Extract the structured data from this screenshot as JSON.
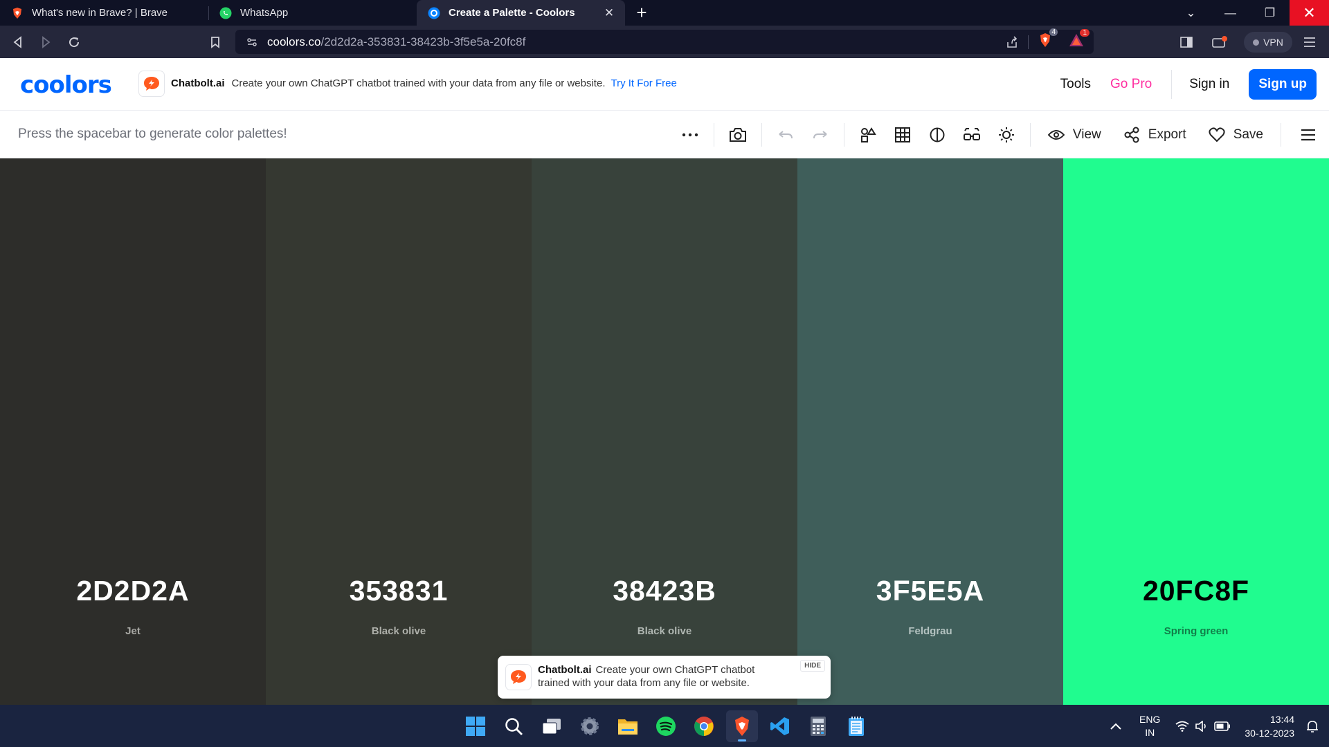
{
  "browser": {
    "tabs": [
      {
        "title": "What's new in Brave? | Brave",
        "icon": "brave-icon",
        "active": false
      },
      {
        "title": "WhatsApp",
        "icon": "whatsapp-icon",
        "active": false
      },
      {
        "title": "Create a Palette - Coolors",
        "icon": "coolors-icon",
        "active": true
      }
    ],
    "url_domain": "coolors.co",
    "url_path": "/2d2d2a-353831-38423b-3f5e5a-20fc8f",
    "shields_count": "4",
    "rewards_count": "1",
    "vpn_label": "VPN"
  },
  "header": {
    "logo": "coolors",
    "ad_brand": "Chatbolt.ai",
    "ad_text": "Create your own ChatGPT chatbot trained with your data from any file or website.",
    "ad_cta": "Try It For Free",
    "tools_label": "Tools",
    "gopro_label": "Go Pro",
    "signin_label": "Sign in",
    "signup_label": "Sign up"
  },
  "toolbar": {
    "hint": "Press the spacebar to generate color palettes!",
    "view_label": "View",
    "export_label": "Export",
    "save_label": "Save"
  },
  "palette": [
    {
      "hex": "2D2D2A",
      "name": "Jet",
      "color": "#2d2d2a",
      "text_color": "#ffffff",
      "name_color": "#a9a9a5"
    },
    {
      "hex": "353831",
      "name": "Black olive",
      "color": "#353831",
      "text_color": "#ffffff",
      "name_color": "#aeb0aa"
    },
    {
      "hex": "38423B",
      "name": "Black olive",
      "color": "#38423b",
      "text_color": "#ffffff",
      "name_color": "#b0b7b2"
    },
    {
      "hex": "3F5E5A",
      "name": "Feldgrau",
      "color": "#3f5e5a",
      "text_color": "#ffffff",
      "name_color": "#b3c2c0"
    },
    {
      "hex": "20FC8F",
      "name": "Spring green",
      "color": "#20fc8f",
      "text_color": "#000000",
      "name_color": "#11804a"
    }
  ],
  "floating_ad": {
    "brand": "Chatbolt.ai",
    "text": "Create your own ChatGPT chatbot trained with your data from any file or website.",
    "hide_label": "HIDE"
  },
  "taskbar": {
    "apps": [
      "start-icon",
      "search-icon",
      "task-view-icon",
      "settings-icon",
      "file-explorer-icon",
      "spotify-icon",
      "chrome-icon",
      "brave-icon",
      "vscode-icon",
      "calculator-icon",
      "notepad-icon"
    ],
    "lang_line1": "ENG",
    "lang_line2": "IN",
    "time": "13:44",
    "date": "30-12-2023"
  }
}
